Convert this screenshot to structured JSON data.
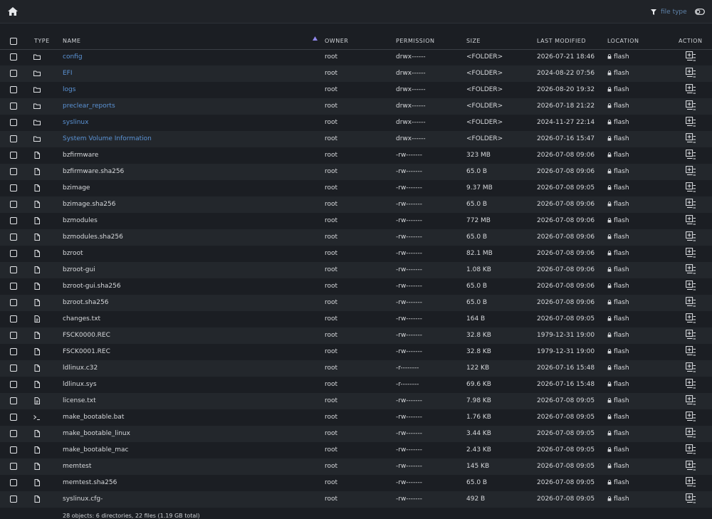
{
  "toolbar": {
    "home_icon": "home-icon",
    "filter_placeholder": "file type",
    "filter_icon": "filter-icon",
    "toggle_icon": "toggle-icon"
  },
  "columns": {
    "type": "TYPE",
    "name": "NAME",
    "owner": "OWNER",
    "permission": "PERMISSION",
    "size": "SIZE",
    "last_modified": "LAST MODIFIED",
    "location": "LOCATION",
    "action": "ACTION"
  },
  "sort": {
    "column": "name",
    "direction": "ascending"
  },
  "colors": {
    "folder_link": "#5b93d5",
    "row_alt": "#23272c",
    "background": "#1b1e23"
  },
  "rows": [
    {
      "type": "folder",
      "name": "config",
      "owner": "root",
      "perm": "drwx------",
      "size": "<FOLDER>",
      "modified": "2026-07-21 18:46",
      "location": "flash"
    },
    {
      "type": "folder",
      "name": "EFI",
      "owner": "root",
      "perm": "drwx------",
      "size": "<FOLDER>",
      "modified": "2024-08-22 07:56",
      "location": "flash"
    },
    {
      "type": "folder",
      "name": "logs",
      "owner": "root",
      "perm": "drwx------",
      "size": "<FOLDER>",
      "modified": "2026-08-20 19:32",
      "location": "flash"
    },
    {
      "type": "folder",
      "name": "preclear_reports",
      "owner": "root",
      "perm": "drwx------",
      "size": "<FOLDER>",
      "modified": "2026-07-18 21:22",
      "location": "flash"
    },
    {
      "type": "folder",
      "name": "syslinux",
      "owner": "root",
      "perm": "drwx------",
      "size": "<FOLDER>",
      "modified": "2024-11-27 22:14",
      "location": "flash"
    },
    {
      "type": "folder",
      "name": "System Volume Information",
      "owner": "root",
      "perm": "drwx------",
      "size": "<FOLDER>",
      "modified": "2026-07-16 15:47",
      "location": "flash"
    },
    {
      "type": "file",
      "name": "bzfirmware",
      "owner": "root",
      "perm": "-rw-------",
      "size": "323 MB",
      "modified": "2026-07-08 09:06",
      "location": "flash"
    },
    {
      "type": "file",
      "name": "bzfirmware.sha256",
      "owner": "root",
      "perm": "-rw-------",
      "size": "65.0 B",
      "modified": "2026-07-08 09:06",
      "location": "flash"
    },
    {
      "type": "file",
      "name": "bzimage",
      "owner": "root",
      "perm": "-rw-------",
      "size": "9.37 MB",
      "modified": "2026-07-08 09:05",
      "location": "flash"
    },
    {
      "type": "file",
      "name": "bzimage.sha256",
      "owner": "root",
      "perm": "-rw-------",
      "size": "65.0 B",
      "modified": "2026-07-08 09:06",
      "location": "flash"
    },
    {
      "type": "file",
      "name": "bzmodules",
      "owner": "root",
      "perm": "-rw-------",
      "size": "772 MB",
      "modified": "2026-07-08 09:06",
      "location": "flash"
    },
    {
      "type": "file",
      "name": "bzmodules.sha256",
      "owner": "root",
      "perm": "-rw-------",
      "size": "65.0 B",
      "modified": "2026-07-08 09:06",
      "location": "flash"
    },
    {
      "type": "file",
      "name": "bzroot",
      "owner": "root",
      "perm": "-rw-------",
      "size": "82.1 MB",
      "modified": "2026-07-08 09:06",
      "location": "flash"
    },
    {
      "type": "file",
      "name": "bzroot-gui",
      "owner": "root",
      "perm": "-rw-------",
      "size": "1.08 KB",
      "modified": "2026-07-08 09:06",
      "location": "flash"
    },
    {
      "type": "file",
      "name": "bzroot-gui.sha256",
      "owner": "root",
      "perm": "-rw-------",
      "size": "65.0 B",
      "modified": "2026-07-08 09:06",
      "location": "flash"
    },
    {
      "type": "file",
      "name": "bzroot.sha256",
      "owner": "root",
      "perm": "-rw-------",
      "size": "65.0 B",
      "modified": "2026-07-08 09:06",
      "location": "flash"
    },
    {
      "type": "text",
      "name": "changes.txt",
      "owner": "root",
      "perm": "-rw-------",
      "size": "164 B",
      "modified": "2026-07-08 09:05",
      "location": "flash"
    },
    {
      "type": "file",
      "name": "FSCK0000.REC",
      "owner": "root",
      "perm": "-rw-------",
      "size": "32.8 KB",
      "modified": "1979-12-31 19:00",
      "location": "flash"
    },
    {
      "type": "file",
      "name": "FSCK0001.REC",
      "owner": "root",
      "perm": "-rw-------",
      "size": "32.8 KB",
      "modified": "1979-12-31 19:00",
      "location": "flash"
    },
    {
      "type": "file",
      "name": "ldlinux.c32",
      "owner": "root",
      "perm": "-r--------",
      "size": "122 KB",
      "modified": "2026-07-16 15:48",
      "location": "flash"
    },
    {
      "type": "file",
      "name": "ldlinux.sys",
      "owner": "root",
      "perm": "-r--------",
      "size": "69.6 KB",
      "modified": "2026-07-16 15:48",
      "location": "flash"
    },
    {
      "type": "text",
      "name": "license.txt",
      "owner": "root",
      "perm": "-rw-------",
      "size": "7.98 KB",
      "modified": "2026-07-08 09:05",
      "location": "flash"
    },
    {
      "type": "script",
      "name": "make_bootable.bat",
      "owner": "root",
      "perm": "-rw-------",
      "size": "1.76 KB",
      "modified": "2026-07-08 09:05",
      "location": "flash"
    },
    {
      "type": "file",
      "name": "make_bootable_linux",
      "owner": "root",
      "perm": "-rw-------",
      "size": "3.44 KB",
      "modified": "2026-07-08 09:05",
      "location": "flash"
    },
    {
      "type": "file",
      "name": "make_bootable_mac",
      "owner": "root",
      "perm": "-rw-------",
      "size": "2.43 KB",
      "modified": "2026-07-08 09:05",
      "location": "flash"
    },
    {
      "type": "file",
      "name": "memtest",
      "owner": "root",
      "perm": "-rw-------",
      "size": "145 KB",
      "modified": "2026-07-08 09:05",
      "location": "flash"
    },
    {
      "type": "file",
      "name": "memtest.sha256",
      "owner": "root",
      "perm": "-rw-------",
      "size": "65.0 B",
      "modified": "2026-07-08 09:05",
      "location": "flash"
    },
    {
      "type": "file",
      "name": "syslinux.cfg-",
      "owner": "root",
      "perm": "-rw-------",
      "size": "492 B",
      "modified": "2026-07-08 09:05",
      "location": "flash"
    }
  ],
  "footer": "28 objects: 6 directories, 22 files (1.19 GB total)"
}
